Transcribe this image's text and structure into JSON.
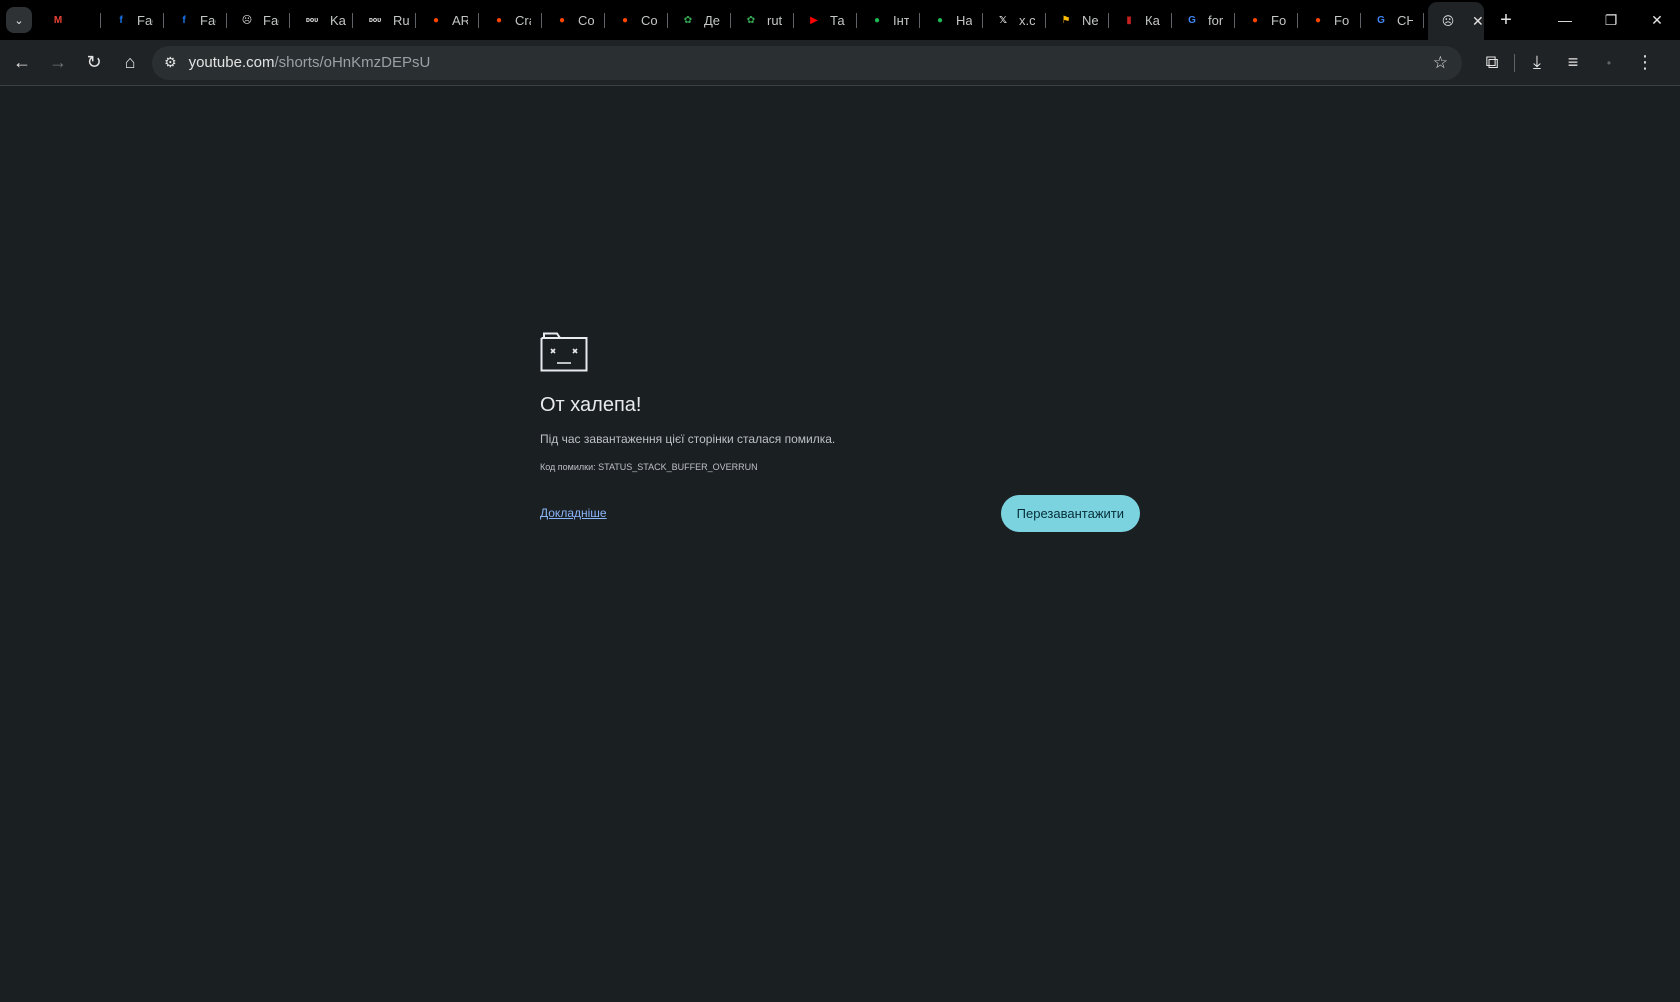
{
  "tabs": [
    {
      "title": "",
      "icon": "gmail-icon",
      "color": "#ea4335",
      "glyph": "M"
    },
    {
      "title": "Fac",
      "icon": "facebook-icon",
      "color": "#1877f2",
      "glyph": "f"
    },
    {
      "title": "Fac",
      "icon": "facebook-icon",
      "color": "#1877f2",
      "glyph": "f"
    },
    {
      "title": "Fac",
      "icon": "sad-tab-icon",
      "color": "#e3e3e3",
      "glyph": "☹"
    },
    {
      "title": "Ka",
      "icon": "dou-icon",
      "color": "#e3e3e3",
      "glyph": "ᴅᴏᴜ"
    },
    {
      "title": "Ru",
      "icon": "dou-icon",
      "color": "#e3e3e3",
      "glyph": "ᴅᴏᴜ"
    },
    {
      "title": "AR",
      "icon": "reddit-icon",
      "color": "#ff4500",
      "glyph": "●"
    },
    {
      "title": "Cra",
      "icon": "reddit-icon",
      "color": "#ff4500",
      "glyph": "●"
    },
    {
      "title": "Co",
      "icon": "reddit-icon",
      "color": "#ff4500",
      "glyph": "●"
    },
    {
      "title": "Co",
      "icon": "reddit-icon",
      "color": "#ff4500",
      "glyph": "●"
    },
    {
      "title": "Де",
      "icon": "puzzle-icon",
      "color": "#34a853",
      "glyph": "✿"
    },
    {
      "title": "rut",
      "icon": "puzzle-icon",
      "color": "#34a853",
      "glyph": "✿"
    },
    {
      "title": "Та",
      "icon": "youtube-icon",
      "color": "#ff0000",
      "glyph": "▶"
    },
    {
      "title": "Інт",
      "icon": "green-globe-icon",
      "color": "#1db954",
      "glyph": "●"
    },
    {
      "title": "На",
      "icon": "green-globe-icon",
      "color": "#1db954",
      "glyph": "●"
    },
    {
      "title": "x.co",
      "icon": "x-icon",
      "color": "#e3e3e3",
      "glyph": "𝕏"
    },
    {
      "title": "Ne",
      "icon": "flag-icon",
      "color": "#fbbc04",
      "glyph": "⚑"
    },
    {
      "title": "Ка",
      "icon": "red-logo-icon",
      "color": "#c5221f",
      "glyph": "▮"
    },
    {
      "title": "for",
      "icon": "google-icon",
      "color": "#4285f4",
      "glyph": "G"
    },
    {
      "title": "Fo",
      "icon": "reddit-icon",
      "color": "#ff4500",
      "glyph": "●"
    },
    {
      "title": "Fo",
      "icon": "reddit-icon",
      "color": "#ff4500",
      "glyph": "●"
    },
    {
      "title": "CH",
      "icon": "google-icon",
      "color": "#4285f4",
      "glyph": "G"
    }
  ],
  "address": {
    "host": "youtube.com",
    "path": "/shorts/oHnKmzDEPsU"
  },
  "error": {
    "title": "От халепа!",
    "message": "Під час завантаження цієї сторінки сталася помилка.",
    "code": "Код помилки: STATUS_STACK_BUFFER_OVERRUN",
    "learn_more": "Докладніше",
    "reload": "Перезавантажити"
  },
  "colors": {
    "accent": "#7cd3e0",
    "background": "#1a1f22",
    "link": "#8ab4f8"
  }
}
